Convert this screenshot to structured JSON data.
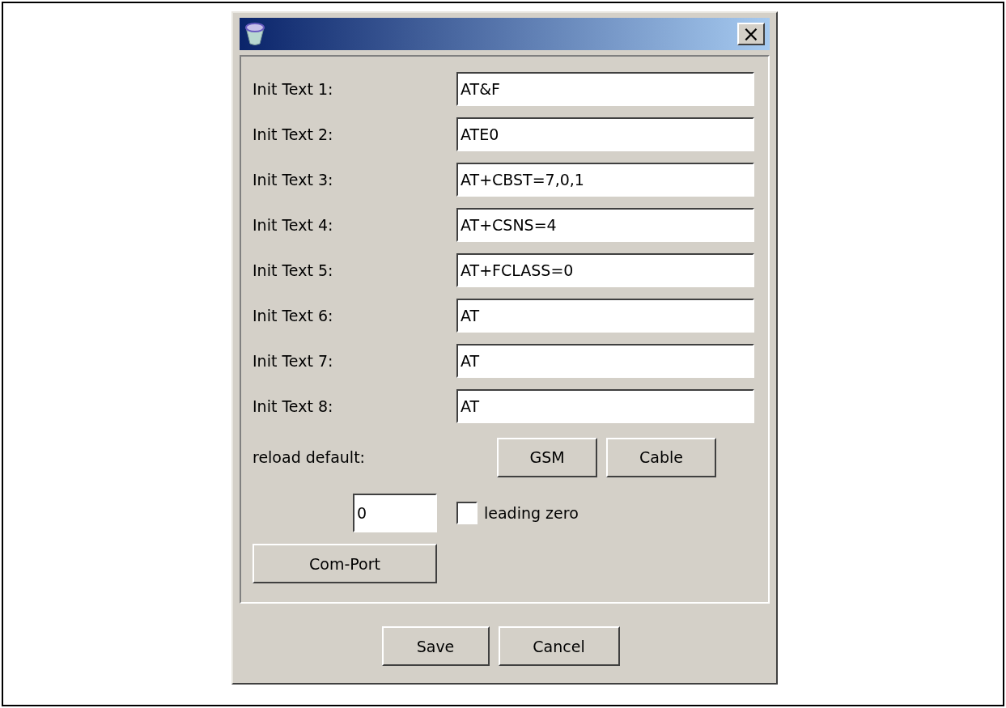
{
  "window": {
    "close_label": "×"
  },
  "init_texts": [
    {
      "label": "Init Text 1:",
      "value": "AT&F"
    },
    {
      "label": "Init Text 2:",
      "value": "ATE0"
    },
    {
      "label": "Init Text 3:",
      "value": "AT+CBST=7,0,1"
    },
    {
      "label": "Init Text 4:",
      "value": "AT+CSNS=4"
    },
    {
      "label": "Init Text 5:",
      "value": "AT+FCLASS=0"
    },
    {
      "label": "Init Text 6:",
      "value": "AT"
    },
    {
      "label": "Init Text 7:",
      "value": "AT"
    },
    {
      "label": "Init Text 8:",
      "value": "AT"
    }
  ],
  "reload_default": {
    "label": "reload default:",
    "buttons": [
      "GSM",
      "Cable"
    ]
  },
  "number_field": {
    "value": "0"
  },
  "leading_zero": {
    "label": "leading zero",
    "checked": false
  },
  "com_port_button": "Com-Port",
  "buttons": [
    "Save",
    "Cancel"
  ]
}
